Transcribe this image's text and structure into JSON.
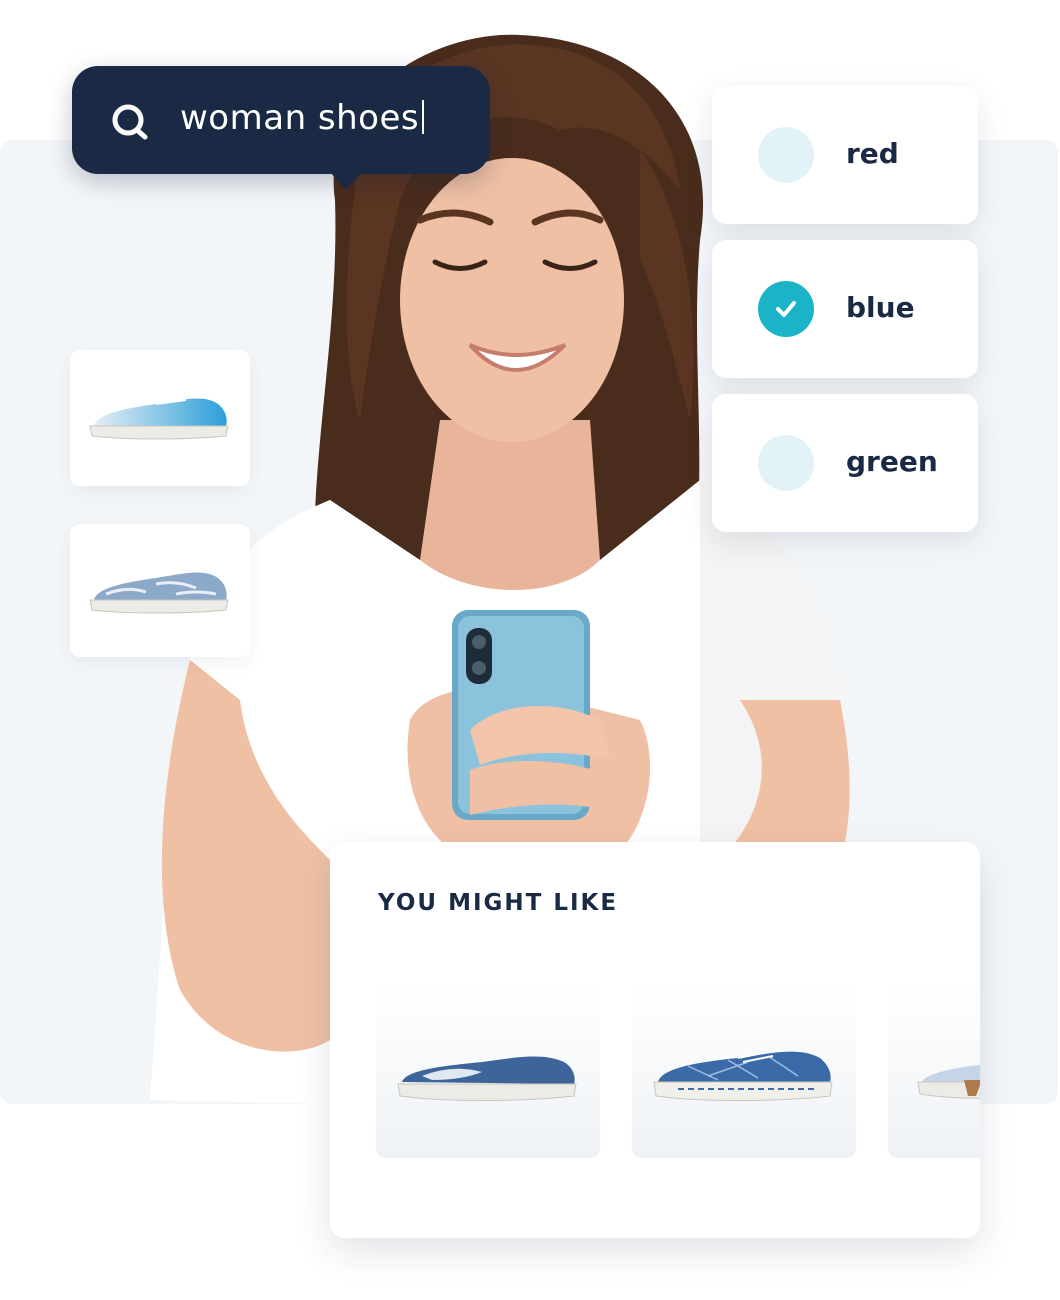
{
  "search": {
    "query": "woman shoes",
    "icon": "search-icon"
  },
  "filters": {
    "options": [
      {
        "label": "red",
        "checked": false
      },
      {
        "label": "blue",
        "checked": true
      },
      {
        "label": "green",
        "checked": false
      }
    ]
  },
  "side_products": [
    {
      "icon": "sneaker-gradient-blue-icon"
    },
    {
      "icon": "sneaker-floral-blue-icon"
    }
  ],
  "recommendations": {
    "title": "YOU MIGHT LIKE",
    "items": [
      {
        "icon": "slip-on-floral-navy-icon"
      },
      {
        "icon": "sneaker-pattern-navy-icon"
      },
      {
        "icon": "sneaker-light-blue-icon"
      }
    ]
  },
  "colors": {
    "navy": "#1b2a44",
    "accent_teal": "#1ab3c8",
    "unchecked_dot": "#e2f3f7",
    "background_panel": "#f3f6f9"
  }
}
